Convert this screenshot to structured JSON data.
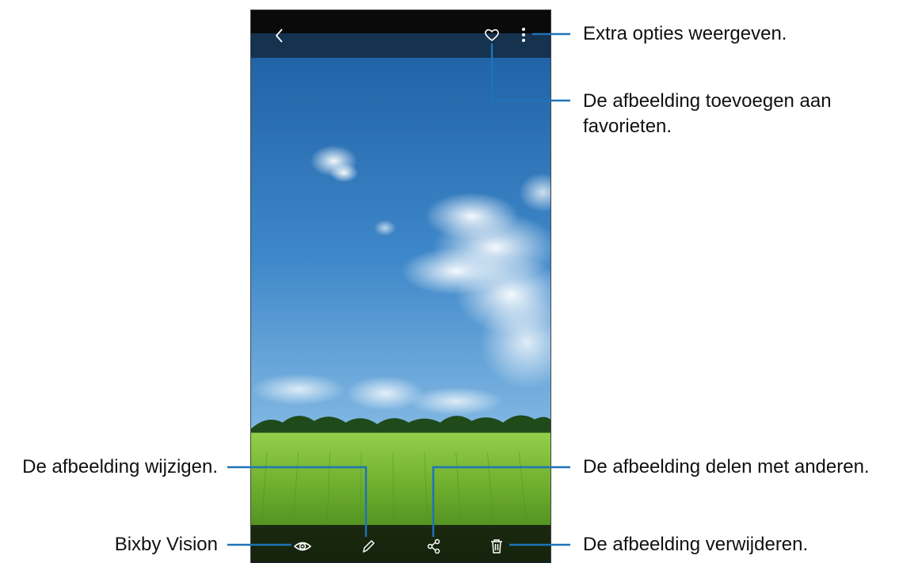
{
  "callouts": {
    "more_options": "Extra opties weergeven.",
    "favorite_line1": "De afbeelding toevoegen aan",
    "favorite_line2": "favorieten.",
    "edit": "De afbeelding wijzigen.",
    "share": "De afbeelding delen met anderen.",
    "bixby": "Bixby Vision",
    "delete": "De afbeelding verwijderen."
  },
  "icons": {
    "back": "chevron-left-icon",
    "favorite": "heart-icon",
    "more": "more-vertical-icon",
    "bixby": "eye-icon",
    "edit": "pencil-icon",
    "share": "share-icon",
    "delete": "trash-icon"
  },
  "colors": {
    "callout_line": "#1e73b8",
    "sky_top": "#1b5ea3",
    "sky_bottom": "#9fc6e6",
    "field": "#7dbb3a"
  }
}
